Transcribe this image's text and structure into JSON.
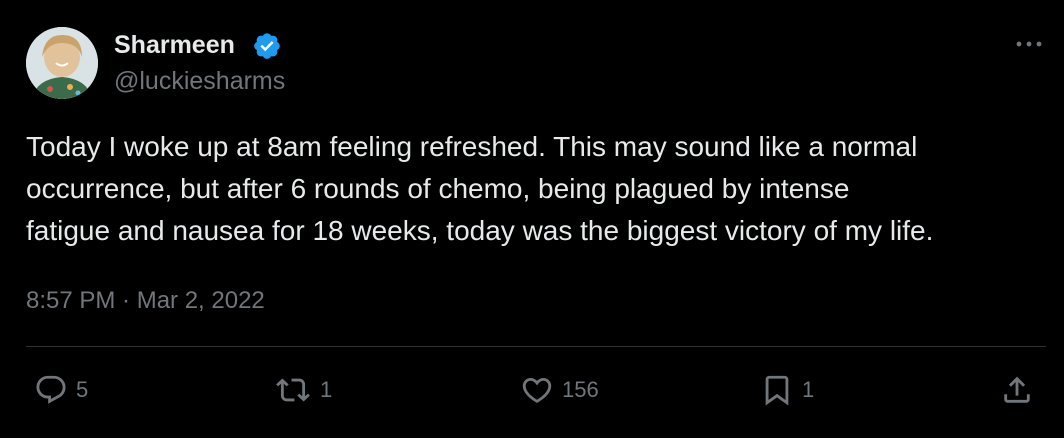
{
  "author": {
    "display_name": "Sharmeen",
    "handle": "@luckiesharms",
    "verified_icon": "verified-badge-icon",
    "verified_color": "#1d9bf0"
  },
  "tweet": {
    "text": "Today I woke up at 8am feeling refreshed. This may sound like a normal\noccurrence, but after 6 rounds of chemo, being plagued by intense\nfatigue and nausea for 18 weeks, today was the biggest victory of my life.",
    "timestamp": "8:57 PM · Mar 2, 2022"
  },
  "actions": {
    "replies": "5",
    "retweets": "1",
    "likes": "156",
    "bookmarks": "1"
  },
  "colors": {
    "background": "#000000",
    "text_primary": "#e7e9ea",
    "text_secondary": "#71767b",
    "divider": "#2f3336"
  }
}
